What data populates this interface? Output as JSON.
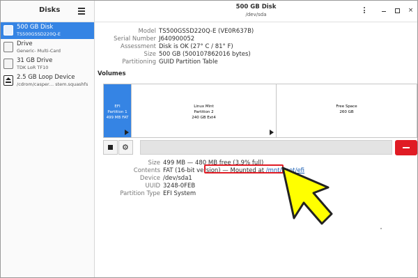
{
  "sidebar": {
    "title": "Disks",
    "devices": [
      {
        "name": "500 GB Disk",
        "sub": "TS500GSSD220Q-E",
        "icon": "disk-icon",
        "selected": true
      },
      {
        "name": "Drive",
        "sub": "Generic- Multi-Card",
        "icon": "disk-icon",
        "selected": false
      },
      {
        "name": "31 GB Drive",
        "sub": "TDK LoR TF10",
        "icon": "disk-icon",
        "selected": false
      },
      {
        "name": "2.5 GB Loop Device",
        "sub": "/cdrom/casper… stem.squashfs",
        "icon": "eject-icon",
        "selected": false
      }
    ]
  },
  "header": {
    "title": "500 GB Disk",
    "subtitle": "/dev/sda",
    "buttons": {
      "min": "",
      "max": "",
      "close": "×"
    }
  },
  "disk_info": [
    {
      "key": "Model",
      "value": "TS500GSSD220Q-E (VE0R637B)"
    },
    {
      "key": "Serial Number",
      "value": "J640900052"
    },
    {
      "key": "Assessment",
      "value": "Disk is OK (27° C / 81° F)"
    },
    {
      "key": "Size",
      "value": "500 GB (500107862016 bytes)"
    },
    {
      "key": "Partitioning",
      "value": "GUID Partition Table"
    }
  ],
  "volumes": {
    "label": "Volumes",
    "partitions": [
      {
        "lines": [
          "EFI",
          "Partition 1",
          "499 MB FAT"
        ],
        "selected": true
      },
      {
        "lines": [
          "Linux Mint",
          "Partition 2",
          "240 GB Ext4"
        ],
        "selected": false
      },
      {
        "lines": [
          "Free Space",
          "260 GB"
        ],
        "selected": false
      }
    ]
  },
  "partition_info": {
    "size": {
      "key": "Size",
      "value": "499 MB — 480 MB free (3.9% full)"
    },
    "contents": {
      "key": "Contents",
      "prefix": "FAT (16-bit version) — ",
      "mounted_text": "Mounted at ",
      "mount_link": "/mnt/boot/efi"
    },
    "device": {
      "key": "Device",
      "value": "/dev/sda1"
    },
    "uuid": {
      "key": "UUID",
      "value": "3248-0FEB"
    },
    "ptype": {
      "key": "Partition Type",
      "value": "EFI System"
    }
  },
  "colors": {
    "accent": "#3584e4",
    "annotation": "#e01b24",
    "arrow": "#ffff00",
    "link": "#1a5fb4"
  }
}
